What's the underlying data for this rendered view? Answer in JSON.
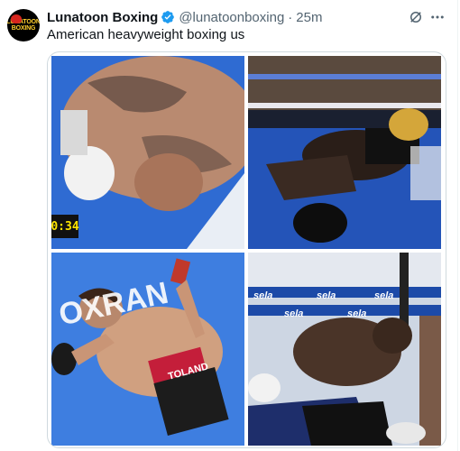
{
  "post": {
    "author_name": "Lunatoon Boxing",
    "handle": "@lunatoonboxing",
    "separator": "·",
    "time": "25m",
    "text": "American heavyweight boxing us",
    "avatar_text": "LUNATOON BOXING"
  },
  "media": {
    "tiles": [
      {
        "icon": "boxer-face-down-photo",
        "badge": "0:34"
      },
      {
        "icon": "boxer-knocked-down-ropes-photo"
      },
      {
        "icon": "boxer-lying-on-canvas-photo",
        "ad_text": "OXRAN",
        "trunks_text": "TOLAND"
      },
      {
        "icon": "boxer-on-ropes-stadium-photo",
        "sponsor": "sela"
      }
    ]
  },
  "colors": {
    "verified": "#1d9bf0",
    "text_primary": "#0f1419",
    "text_secondary": "#536471",
    "border": "#cfd9de"
  }
}
